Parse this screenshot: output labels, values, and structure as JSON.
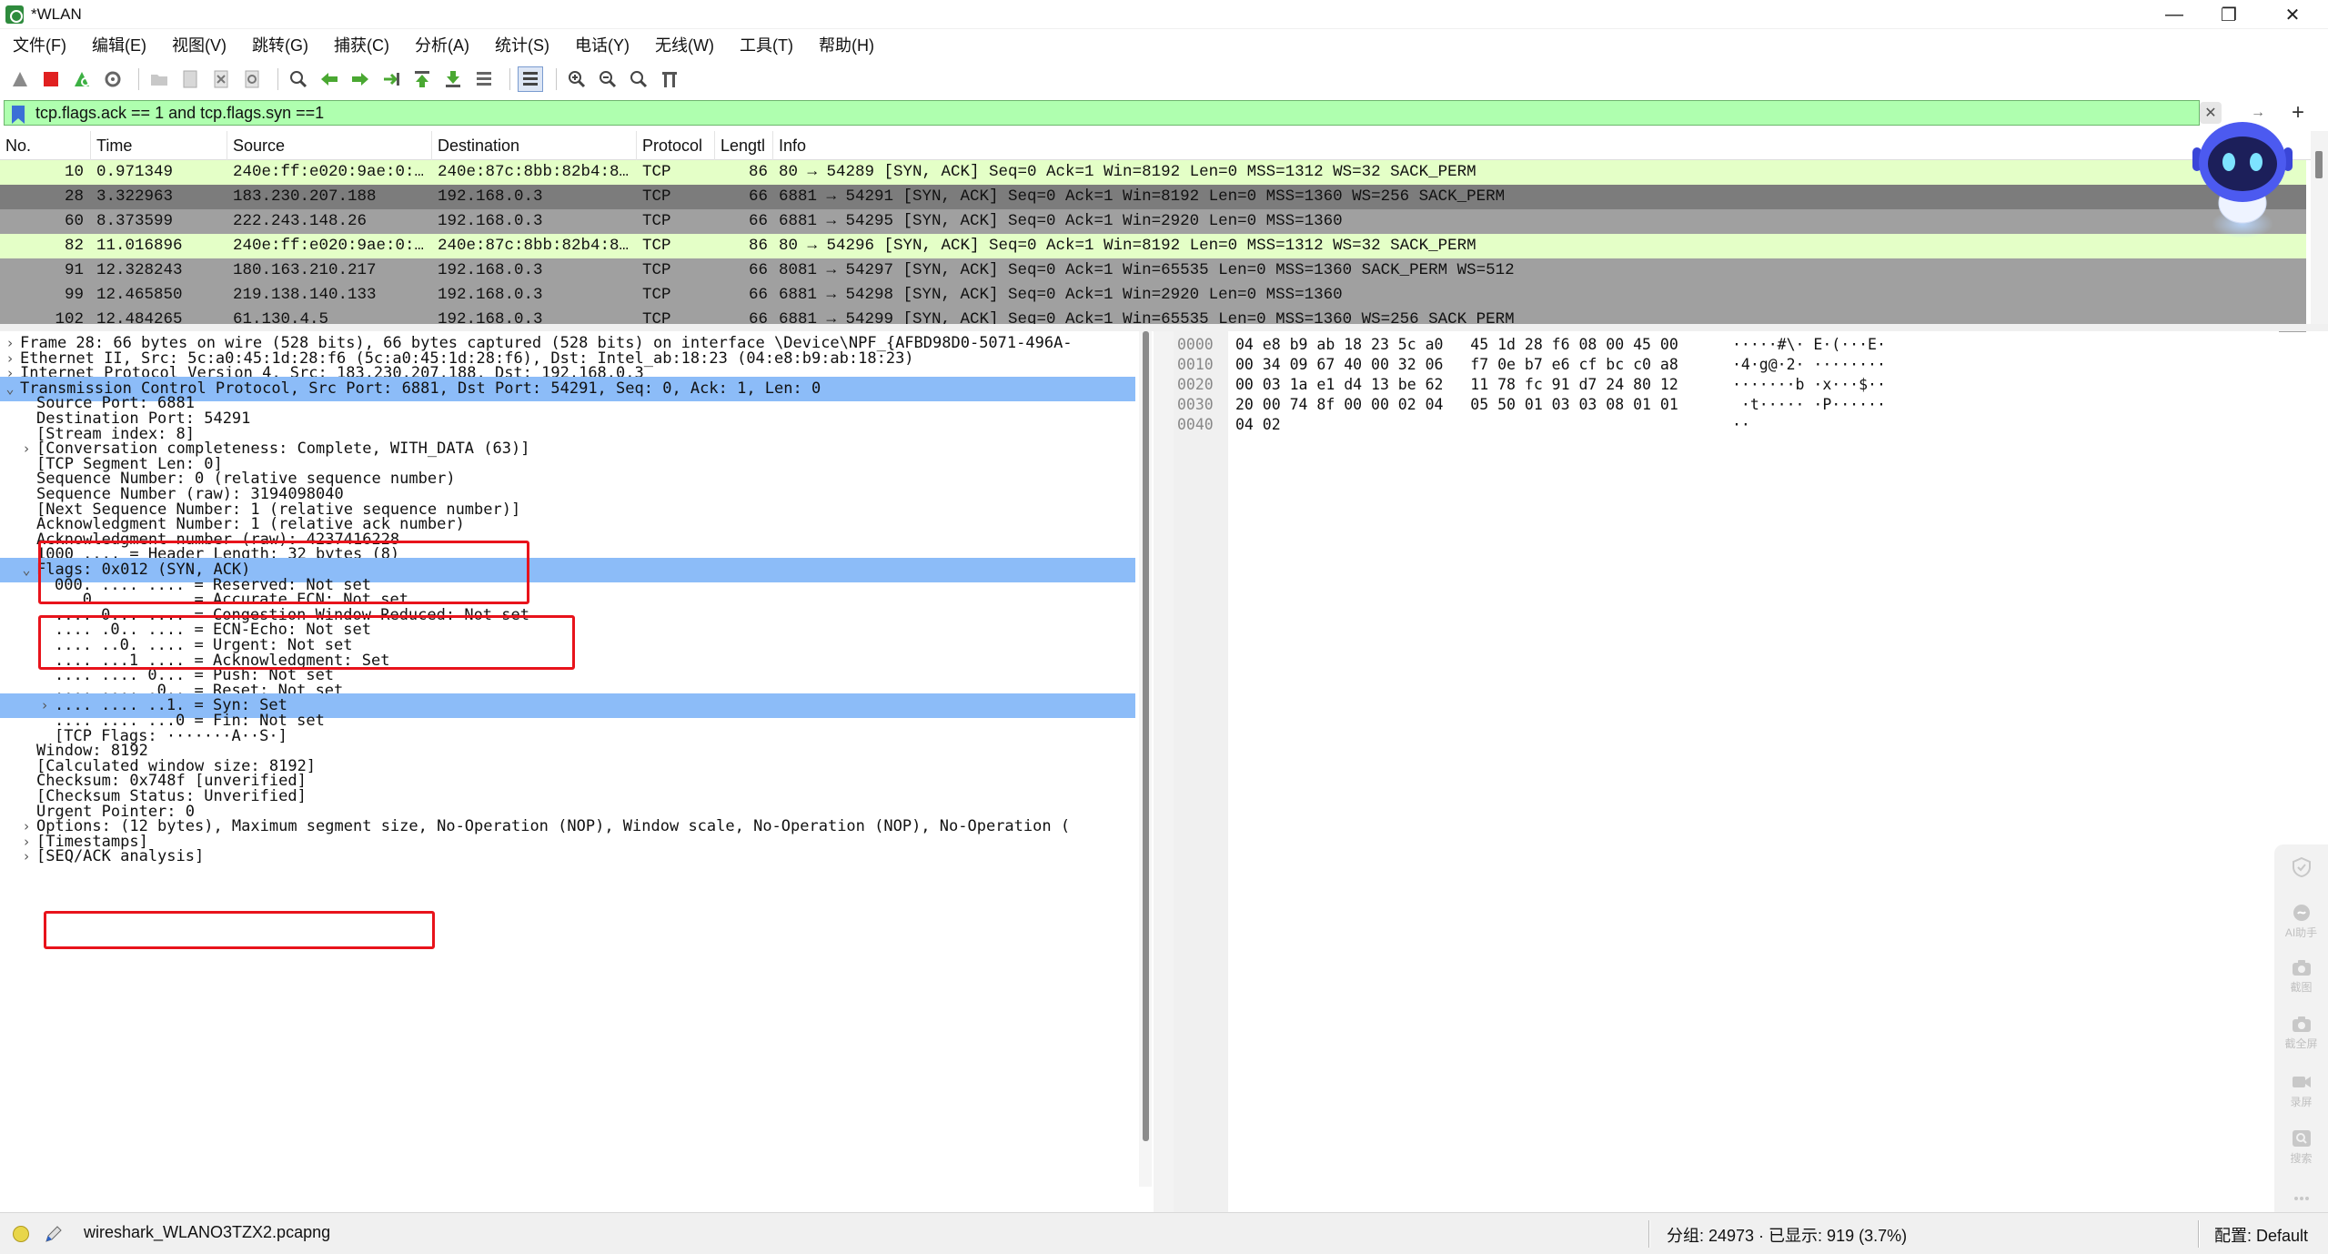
{
  "window": {
    "title": "*WLAN",
    "min_glyph": "—",
    "max_glyph": "❐",
    "close_glyph": "✕"
  },
  "menu": [
    "文件(F)",
    "编辑(E)",
    "视图(V)",
    "跳转(G)",
    "捕获(C)",
    "分析(A)",
    "统计(S)",
    "电话(Y)",
    "无线(W)",
    "工具(T)",
    "帮助(H)"
  ],
  "toolbar": {
    "icons": [
      "shark-fin-start-icon",
      "stop-capture-icon",
      "restart-capture-icon",
      "capture-options-icon",
      "open-file-icon",
      "save-file-icon",
      "close-file-icon",
      "reload-file-icon",
      "find-packet-icon",
      "go-back-icon",
      "go-forward-icon",
      "go-to-packet-icon",
      "go-first-icon",
      "go-last-icon",
      "autoscroll-icon",
      "colorize-icon",
      "zoom-in-icon",
      "zoom-out-icon",
      "zoom-normal-icon",
      "resize-columns-icon"
    ]
  },
  "filter": {
    "value": "tcp.flags.ack == 1 and tcp.flags.syn ==1",
    "clear_glyph": "✕",
    "apply_glyph": "→",
    "add_glyph": "+"
  },
  "packet_list": {
    "columns": [
      "No.",
      "Time",
      "Source",
      "Destination",
      "Protocol",
      "Lengtl",
      "Info"
    ],
    "rows": [
      {
        "no": "10",
        "time": "0.971349",
        "src": "240e:ff:e020:9ae:0:…",
        "dst": "240e:87c:8bb:82b4:8…",
        "proto": "TCP",
        "len": "86",
        "info": "80 → 54289 [SYN, ACK] Seq=0 Ack=1 Win=8192 Len=0 MSS=1312 WS=32 SACK_PERM",
        "style": "green"
      },
      {
        "no": "28",
        "time": "3.322963",
        "src": "183.230.207.188",
        "dst": "192.168.0.3",
        "proto": "TCP",
        "len": "66",
        "info": "6881 → 54291 [SYN, ACK] Seq=0 Ack=1 Win=8192 Len=0 MSS=1360 WS=256 SACK_PERM",
        "style": "selected"
      },
      {
        "no": "60",
        "time": "8.373599",
        "src": "222.243.148.26",
        "dst": "192.168.0.3",
        "proto": "TCP",
        "len": "66",
        "info": "6881 → 54295 [SYN, ACK] Seq=0 Ack=1 Win=2920 Len=0 MSS=1360",
        "style": "gray"
      },
      {
        "no": "82",
        "time": "11.016896",
        "src": "240e:ff:e020:9ae:0:…",
        "dst": "240e:87c:8bb:82b4:8…",
        "proto": "TCP",
        "len": "86",
        "info": "80 → 54296 [SYN, ACK] Seq=0 Ack=1 Win=8192 Len=0 MSS=1312 WS=32 SACK_PERM",
        "style": "green"
      },
      {
        "no": "91",
        "time": "12.328243",
        "src": "180.163.210.217",
        "dst": "192.168.0.3",
        "proto": "TCP",
        "len": "66",
        "info": "8081 → 54297 [SYN, ACK] Seq=0 Ack=1 Win=65535 Len=0 MSS=1360 SACK_PERM WS=512",
        "style": "gray"
      },
      {
        "no": "99",
        "time": "12.465850",
        "src": "219.138.140.133",
        "dst": "192.168.0.3",
        "proto": "TCP",
        "len": "66",
        "info": "6881 → 54298 [SYN, ACK] Seq=0 Ack=1 Win=2920 Len=0 MSS=1360",
        "style": "gray"
      },
      {
        "no": "102",
        "time": "12.484265",
        "src": "61.130.4.5",
        "dst": "192.168.0.3",
        "proto": "TCP",
        "len": "66",
        "info": "6881 → 54299 [SYN, ACK] Seq=0 Ack=1 Win=65535 Len=0 MSS=1360 WS=256 SACK_PERM",
        "style": "gray"
      }
    ]
  },
  "details": {
    "lines": [
      {
        "arrow": "›",
        "indent": 0,
        "text": "Frame 28: 66 bytes on wire (528 bits), 66 bytes captured (528 bits) on interface \\Device\\NPF_{AFBD98D0-5071-496A-",
        "sel": false
      },
      {
        "arrow": "›",
        "indent": 0,
        "text": "Ethernet II, Src: 5c:a0:45:1d:28:f6 (5c:a0:45:1d:28:f6), Dst: Intel_ab:18:23 (04:e8:b9:ab:18:23)",
        "sel": false
      },
      {
        "arrow": "›",
        "indent": 0,
        "text": "Internet Protocol Version 4, Src: 183.230.207.188, Dst: 192.168.0.3",
        "sel": false
      },
      {
        "arrow": "⌄",
        "indent": 0,
        "text": "Transmission Control Protocol, Src Port: 6881, Dst Port: 54291, Seq: 0, Ack: 1, Len: 0",
        "sel": true
      },
      {
        "arrow": "",
        "indent": 1,
        "text": "Source Port: 6881",
        "sel": false
      },
      {
        "arrow": "",
        "indent": 1,
        "text": "Destination Port: 54291",
        "sel": false
      },
      {
        "arrow": "",
        "indent": 1,
        "text": "[Stream index: 8]",
        "sel": false
      },
      {
        "arrow": "›",
        "indent": 1,
        "text": "[Conversation completeness: Complete, WITH_DATA (63)]",
        "sel": false
      },
      {
        "arrow": "",
        "indent": 1,
        "text": "[TCP Segment Len: 0]",
        "sel": false
      },
      {
        "arrow": "",
        "indent": 1,
        "text": "Sequence Number: 0    (relative sequence number)",
        "sel": false
      },
      {
        "arrow": "",
        "indent": 1,
        "text": "Sequence Number (raw): 3194098040",
        "sel": false
      },
      {
        "arrow": "",
        "indent": 1,
        "text": "[Next Sequence Number: 1    (relative sequence number)]",
        "sel": false
      },
      {
        "arrow": "",
        "indent": 1,
        "text": "Acknowledgment Number: 1    (relative ack number)",
        "sel": false
      },
      {
        "arrow": "",
        "indent": 1,
        "text": "Acknowledgment number (raw): 4237416228",
        "sel": false
      },
      {
        "arrow": "",
        "indent": 1,
        "text": "1000 .... = Header Length: 32 bytes (8)",
        "sel": false
      },
      {
        "arrow": "⌄",
        "indent": 1,
        "text": "Flags: 0x012 (SYN, ACK)",
        "sel": true
      },
      {
        "arrow": "",
        "indent": 2,
        "text": "000. .... .... = Reserved: Not set",
        "sel": false
      },
      {
        "arrow": "",
        "indent": 2,
        "text": "...0 .... .... = Accurate ECN: Not set",
        "sel": false
      },
      {
        "arrow": "",
        "indent": 2,
        "text": ".... 0... .... = Congestion Window Reduced: Not set",
        "sel": false
      },
      {
        "arrow": "",
        "indent": 2,
        "text": ".... .0.. .... = ECN-Echo: Not set",
        "sel": false
      },
      {
        "arrow": "",
        "indent": 2,
        "text": ".... ..0. .... = Urgent: Not set",
        "sel": false
      },
      {
        "arrow": "",
        "indent": 2,
        "text": ".... ...1 .... = Acknowledgment: Set",
        "sel": false
      },
      {
        "arrow": "",
        "indent": 2,
        "text": ".... .... 0... = Push: Not set",
        "sel": false
      },
      {
        "arrow": "",
        "indent": 2,
        "text": ".... .... .0.. = Reset: Not set",
        "sel": false
      },
      {
        "arrow": "›",
        "indent": 2,
        "text": ".... .... ..1. = Syn: Set",
        "sel": true
      },
      {
        "arrow": "",
        "indent": 2,
        "text": ".... .... ...0 = Fin: Not set",
        "sel": false
      },
      {
        "arrow": "",
        "indent": 2,
        "text": "[TCP Flags: ·······A··S·]",
        "sel": false
      },
      {
        "arrow": "",
        "indent": 1,
        "text": "Window: 8192",
        "sel": false
      },
      {
        "arrow": "",
        "indent": 1,
        "text": "[Calculated window size: 8192]",
        "sel": false
      },
      {
        "arrow": "",
        "indent": 1,
        "text": "Checksum: 0x748f [unverified]",
        "sel": false
      },
      {
        "arrow": "",
        "indent": 1,
        "text": "[Checksum Status: Unverified]",
        "sel": false
      },
      {
        "arrow": "",
        "indent": 1,
        "text": "Urgent Pointer: 0",
        "sel": false
      },
      {
        "arrow": "›",
        "indent": 1,
        "text": "Options: (12 bytes), Maximum segment size, No-Operation (NOP), Window scale, No-Operation (NOP), No-Operation (",
        "sel": false
      },
      {
        "arrow": "›",
        "indent": 1,
        "text": "[Timestamps]",
        "sel": false
      },
      {
        "arrow": "›",
        "indent": 1,
        "text": "[SEQ/ACK analysis]",
        "sel": false
      }
    ]
  },
  "bytes": {
    "offsets": [
      "0000",
      "0010",
      "0020",
      "0030",
      "0040"
    ],
    "hex": [
      "04 e8 b9 ab 18 23 5c a0   45 1d 28 f6 08 00 45 00",
      "00 34 09 67 40 00 32 06   f7 0e b7 e6 cf bc c0 a8",
      "00 03 1a e1 d4 13 be 62   11 78 fc 91 d7 24 80 12",
      "20 00 74 8f 00 00 02 04   05 50 01 03 03 08 01 01",
      "04 02"
    ],
    "ascii": [
      "·····#\\· E·(···E·",
      "·4·g@·2· ········",
      "·······b ·x···$··",
      " ·t····· ·P······",
      "··"
    ]
  },
  "side_tools": [
    "AI助手",
    "截图",
    "截全屏",
    "录屏",
    "搜索"
  ],
  "status": {
    "file": "wireshark_WLANO3TZX2.pcapng",
    "counts": "分组: 24973 · 已显示: 919 (3.7%)",
    "profile": "配置: Default"
  },
  "colors": {
    "filter_valid_bg": "#afffaf",
    "row_green": "#e4ffc7",
    "row_gray": "#a0a0a0",
    "detail_selected": "#8cbcf8",
    "annotation_red": "#e8131b"
  }
}
